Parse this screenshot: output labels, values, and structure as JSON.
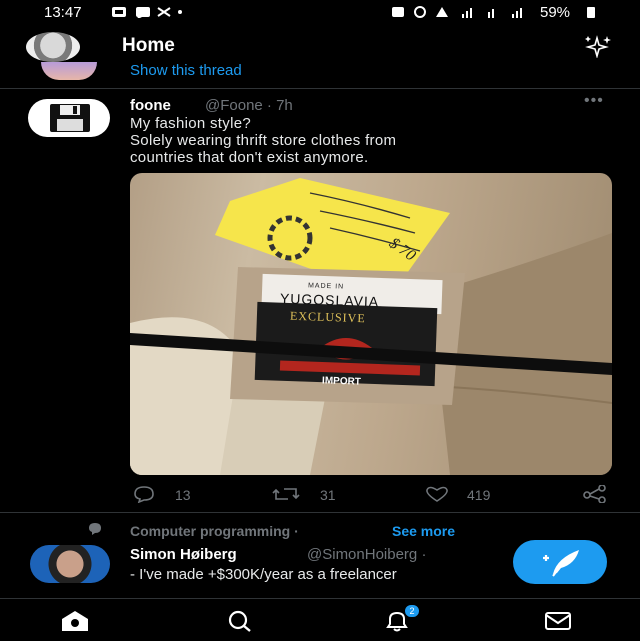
{
  "status_bar": {
    "time": "13:47",
    "battery": "59%"
  },
  "header": {
    "title": "Home",
    "sparkle_icon": "sparkle-icon"
  },
  "thread_prompt": {
    "show_thread": "Show this thread"
  },
  "tweet": {
    "name": "foone",
    "handle_time": "@Foone · 7h",
    "text_lines": [
      "My fashion style?",
      "Solely wearing thrift store clothes from",
      "countries that don't exist anymore."
    ],
    "photo": {
      "tag_text": "Made in",
      "country": "YUGOSLAVIA",
      "brand": "EXCLUSIVE",
      "import": "IMPORT",
      "price_tag": "$ 70"
    },
    "actions": {
      "replies": "13",
      "retweets": "31",
      "likes": "419"
    }
  },
  "topic": {
    "label": "Computer programming ·",
    "see_more": "See more"
  },
  "next_tweet": {
    "name": "Simon Høiberg",
    "handle": "@SimonHoiberg ·",
    "text": "- I've made +$300K/year as a freelancer"
  },
  "bottom_nav": {
    "notifications_badge": "2"
  },
  "colors": {
    "accent": "#1d9bf0",
    "muted": "#71767b",
    "background": "#000000"
  }
}
